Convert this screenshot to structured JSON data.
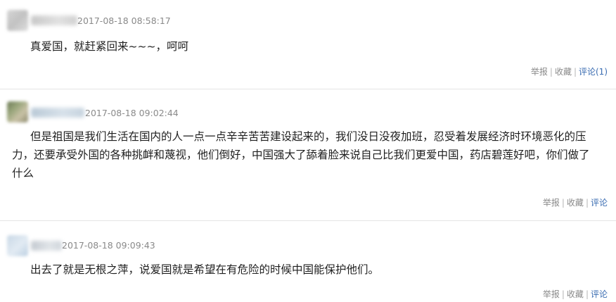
{
  "comments": [
    {
      "timestamp": "2017-08-18 08:58:17",
      "lines": [
        "真爱国，就赶紧回来~~~，呵呵"
      ],
      "actions": {
        "report": "举报",
        "favorite": "收藏",
        "comment": "评论(1)"
      }
    },
    {
      "timestamp": "2017-08-18 09:02:44",
      "lines": [
        "但是祖国是我们生活在国内的人一点一点辛辛苦苦建设起来的，我们没日没夜加班，忍受着发展经济时环境恶化的压",
        "力，还要承受外国的各种挑衅和蔑视，他们倒好，中国强大了舔着脸来说自己比我们更爱中国，药店碧莲好吧，你们做了",
        "什么"
      ],
      "actions": {
        "report": "举报",
        "favorite": "收藏",
        "comment": "评论"
      }
    },
    {
      "timestamp": "2017-08-18 09:09:43",
      "lines": [
        "出去了就是无根之萍，说爱国就是希望在有危险的时候中国能保护他们。"
      ],
      "actions": {
        "report": "举报",
        "favorite": "收藏",
        "comment": "评论"
      }
    }
  ],
  "separator": "|"
}
